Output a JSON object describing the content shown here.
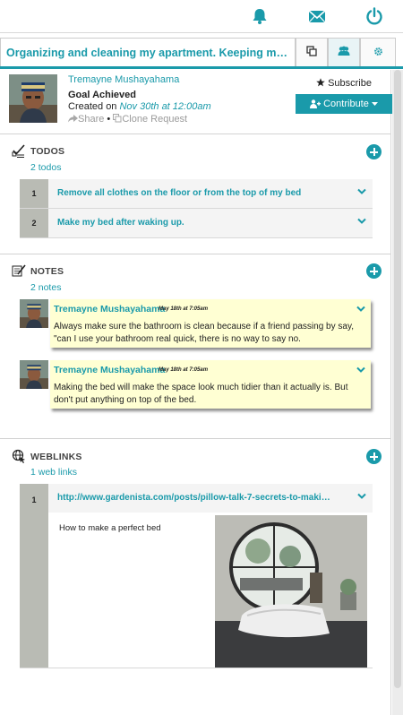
{
  "header_icons": [
    "bell-icon",
    "envelope-icon",
    "power-icon"
  ],
  "tabs": {
    "title": "Organizing and cleaning my apartment. Keeping my apartment clean.",
    "icons": [
      "copy-icon",
      "users-icon",
      "gear-icon"
    ]
  },
  "goal": {
    "owner": "Tremayne Mushayahama",
    "status": "Goal Achieved",
    "created_prefix": "Created on ",
    "created_date": "Nov 30th at 12:00am",
    "share_label": "Share",
    "separator": "•",
    "clone_label": "Clone Request",
    "subscribe_label": "Subscribe",
    "contribute_label": "Contribute"
  },
  "todos": {
    "title": "TODOS",
    "count": "2 todos",
    "items": [
      {
        "num": "1",
        "text": "Remove all clothes on the floor or from the top of my bed"
      },
      {
        "num": "2",
        "text": "Make my bed after waking up."
      }
    ]
  },
  "notes": {
    "title": "NOTES",
    "count": "2 notes",
    "items": [
      {
        "author": "Tremayne Mushayahama",
        "date": "May 18th at 7:05am",
        "body": "Always make sure the bathroom is clean because if a friend passing by say, \"can I use your bathroom real quick, there is no way to say no."
      },
      {
        "author": "Tremayne Mushayahama",
        "date": "May 18th at 7:05am",
        "body": "Making the bed will make the space look much tidier than it actually is. But don't put anything on top of the bed."
      }
    ]
  },
  "weblinks": {
    "title": "WEBLINKS",
    "count": "1 web links",
    "items": [
      {
        "num": "1",
        "url": "http://www.gardenista.com/posts/pillow-talk-7-secrets-to-making-...",
        "description": "How to make a perfect bed"
      }
    ]
  },
  "colors": {
    "accent": "#1a9aaa",
    "note_bg": "#ffffd3",
    "index_bg": "#b9bbb4"
  }
}
